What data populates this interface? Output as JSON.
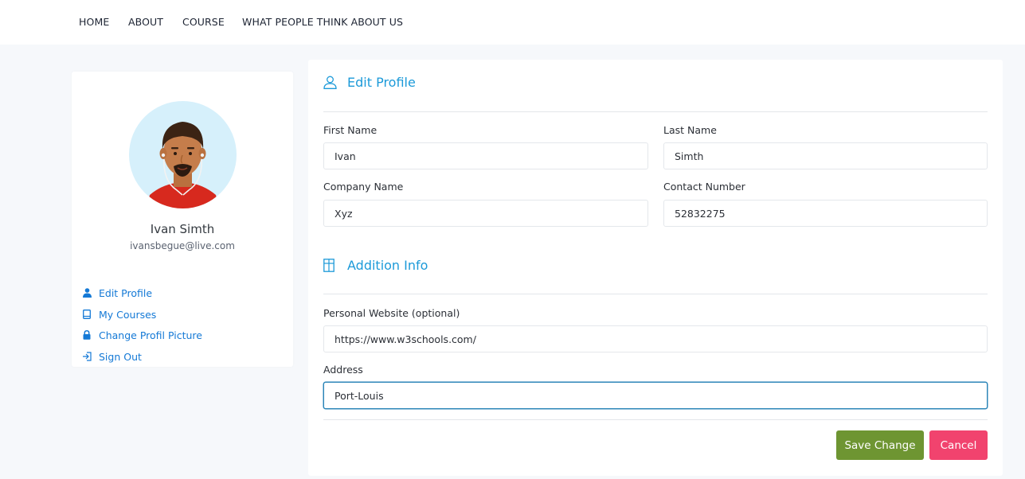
{
  "nav": {
    "items": [
      "HOME",
      "ABOUT",
      "COURSE",
      "WHAT PEOPLE THINK ABOUT US"
    ]
  },
  "profile": {
    "name": "Ivan Simth",
    "email": "ivansbegue@live.com",
    "avatar_icon": "person-avatar"
  },
  "sidebar": {
    "items": [
      {
        "label": "Edit Profile",
        "icon": "user-icon"
      },
      {
        "label": "My Courses",
        "icon": "book-icon"
      },
      {
        "label": "Change Profil Picture",
        "icon": "lock-icon"
      },
      {
        "label": "Sign Out",
        "icon": "sign-out-icon"
      }
    ]
  },
  "edit_profile": {
    "title": "Edit Profile",
    "first_name_label": "First Name",
    "first_name_value": "Ivan",
    "last_name_label": "Last Name",
    "last_name_value": "Simth",
    "company_label": "Company Name",
    "company_value": "Xyz",
    "contact_label": "Contact Number",
    "contact_value": "52832275"
  },
  "addition_info": {
    "title": "Addition Info",
    "website_label": "Personal Website (optional)",
    "website_value": "https://www.w3schools.com/",
    "address_label": "Address",
    "address_value": "Port-Louis"
  },
  "actions": {
    "save_label": "Save Change",
    "cancel_label": "Cancel"
  },
  "colors": {
    "accent": "#1c9ad9",
    "link": "#1479d6",
    "save": "#6e9532",
    "cancel": "#f1436e"
  }
}
